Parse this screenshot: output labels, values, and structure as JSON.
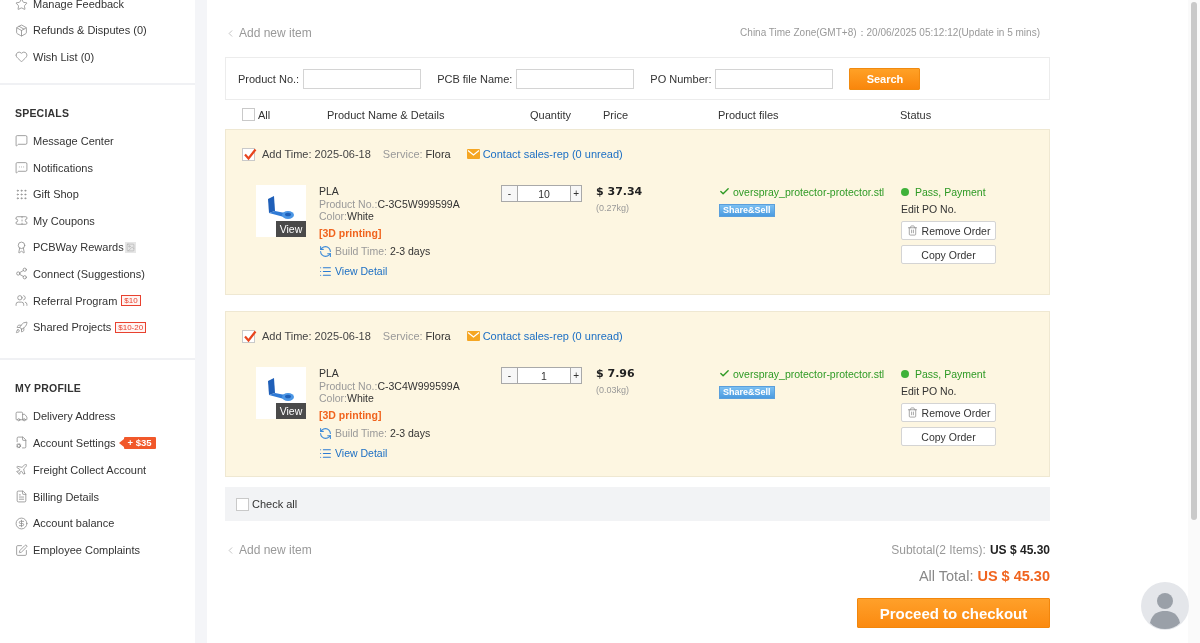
{
  "sidebar": {
    "sections": [
      {
        "items": [
          {
            "label": "Manage Feedback"
          },
          {
            "label": "Refunds & Disputes (0)"
          },
          {
            "label": "Wish List (0)"
          }
        ]
      },
      {
        "heading": "SPECIALS",
        "items": [
          {
            "label": "Message Center"
          },
          {
            "label": "Notifications"
          },
          {
            "label": "Gift Shop"
          },
          {
            "label": "My Coupons"
          },
          {
            "label": "PCBWay Rewards"
          },
          {
            "label": "Connect (Suggestions)"
          },
          {
            "label": "Referral Program",
            "badge": {
              "text": "$10",
              "kind": "outline"
            }
          },
          {
            "label": "Shared Projects",
            "badge": {
              "text": "$10-20",
              "kind": "outline"
            }
          }
        ]
      },
      {
        "heading": "MY PROFILE",
        "items": [
          {
            "label": "Delivery Address"
          },
          {
            "label": "Account Settings",
            "badge": {
              "text": "+ $35",
              "kind": "filled"
            }
          },
          {
            "label": "Freight Collect Account"
          },
          {
            "label": "Billing Details"
          },
          {
            "label": "Account balance"
          },
          {
            "label": "Employee Complaints"
          }
        ]
      }
    ]
  },
  "top_bar": {
    "back_link": "Add new item",
    "timezone": "China Time Zone(GMT+8)：20/06/2025 05:12:12(Update in 5 mins)"
  },
  "filters": {
    "fields": [
      {
        "label": "Product No.:"
      },
      {
        "label": "PCB file Name:"
      },
      {
        "label": "PO Number:"
      }
    ],
    "search_button": "Search"
  },
  "table": {
    "select_all": {
      "label": "All",
      "checked": false
    },
    "columns": [
      "Product Name & Details",
      "Quantity",
      "Price",
      "Product files",
      "Status"
    ]
  },
  "orders": [
    {
      "checked": true,
      "add_time": "Add Time: 2025-06-18",
      "service_label": "Service:",
      "service": "Flora",
      "contact_link": "Contact sales-rep (0 unread)",
      "thumbnail_label": "View",
      "material": "PLA",
      "product_no_label": "Product No.:",
      "product_no": "C-3C5W999599A",
      "material_color_label": "Color:",
      "material_color": "White",
      "process": "[3D printing]",
      "build_time_label": "Build Time:",
      "build_time": "2-3 days",
      "detail_link": "View Detail",
      "quantity": {
        "minus": "-",
        "value": "10",
        "plus": "+"
      },
      "price": "$ 37.34",
      "weight": "(0.27kg)",
      "file": "overspray_protector-protector.stl",
      "share_button": "Share&Sell",
      "status": "Pass, Payment",
      "edit_po": "Edit PO No.",
      "remove_button": "Remove Order",
      "copy_button": "Copy Order"
    },
    {
      "checked": true,
      "add_time": "Add Time: 2025-06-18",
      "service_label": "Service:",
      "service": "Flora",
      "contact_link": "Contact sales-rep (0 unread)",
      "thumbnail_label": "View",
      "material": "PLA",
      "product_no_label": "Product No.:",
      "product_no": "C-3C4W999599A",
      "material_color_label": "Color:",
      "material_color": "White",
      "process": "[3D printing]",
      "build_time_label": "Build Time:",
      "build_time": "2-3 days",
      "detail_link": "View Detail",
      "quantity": {
        "minus": "-",
        "value": "1",
        "plus": "+"
      },
      "price": "$ 7.96",
      "weight": "(0.03kg)",
      "file": "overspray_protector-protector.stl",
      "share_button": "Share&Sell",
      "status": "Pass, Payment",
      "edit_po": "Edit PO No.",
      "remove_button": "Remove Order",
      "copy_button": "Copy Order"
    }
  ],
  "check_all": {
    "label": "Check all",
    "checked": false
  },
  "footer": {
    "back_link": "Add new item",
    "subtotal_label": "Subtotal(2 Items):",
    "subtotal": "US $ 45.30",
    "total_label": "All Total:",
    "total": "US $ 45.30",
    "checkout_button": "Proceed to checkout"
  }
}
